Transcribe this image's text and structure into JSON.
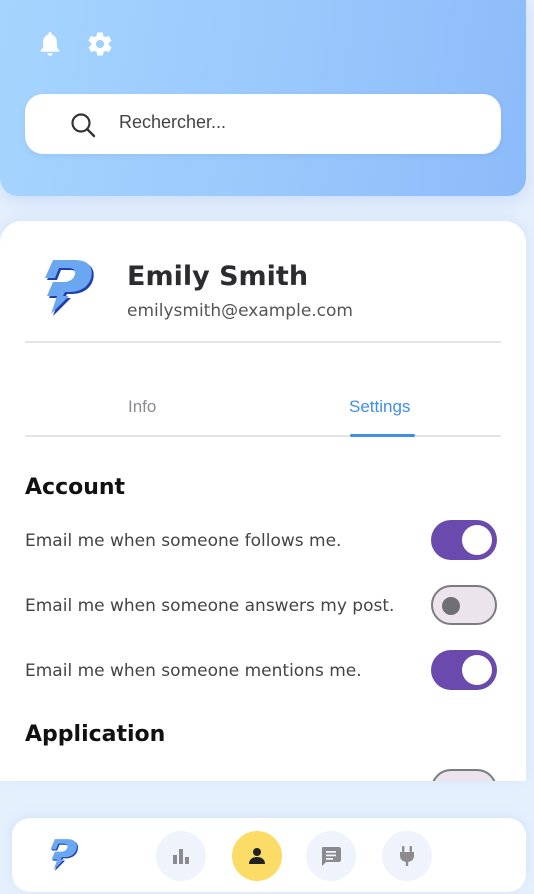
{
  "header": {
    "icons": [
      "bell-icon",
      "gear-icon",
      "search-icon"
    ],
    "search": {
      "placeholder": "Rechercher..."
    }
  },
  "profile": {
    "name": "Emily Smith",
    "email": "emilysmith@example.com"
  },
  "tabs": [
    {
      "label": "Info",
      "active": false
    },
    {
      "label": "Settings",
      "active": true
    }
  ],
  "account": {
    "title": "Account",
    "settings": [
      {
        "label": "Email me when someone follows me.",
        "enabled": true
      },
      {
        "label": "Email me when someone answers my post.",
        "enabled": false
      },
      {
        "label": "Email me when someone mentions me.",
        "enabled": true
      }
    ]
  },
  "application": {
    "title": "Application",
    "settings": [
      {
        "label": "",
        "enabled": false
      }
    ]
  },
  "bottom_nav": {
    "items": [
      {
        "icon": "stats-icon",
        "active": false
      },
      {
        "icon": "user-icon",
        "active": true
      },
      {
        "icon": "message-icon",
        "active": false
      },
      {
        "icon": "plug-icon",
        "active": false
      }
    ]
  },
  "colors": {
    "accent": "#3f8ee8",
    "toggle_on": "#6a4aac",
    "active_nav": "#fbdc67"
  }
}
